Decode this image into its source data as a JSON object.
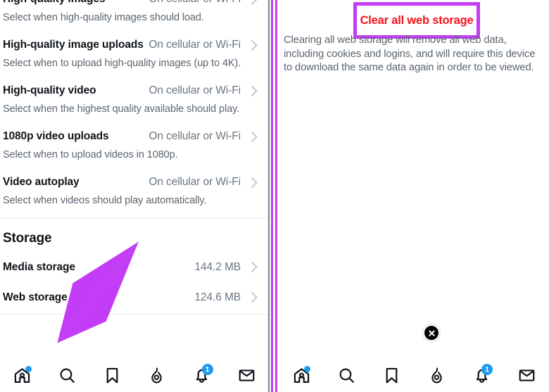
{
  "colors": {
    "accent_purple": "#c23df5",
    "alert_red": "#f4121a",
    "badge_blue": "#1d9bf0",
    "text_primary": "#0f1419",
    "text_secondary": "#5b6570",
    "divider": "#e9eaec"
  },
  "left_panel": {
    "settings_rows": [
      {
        "title": "High-quality images",
        "value": "On cellular or Wi-Fi",
        "description": "Select when high-quality images should load."
      },
      {
        "title": "High-quality image uploads",
        "value": "On cellular or Wi-Fi",
        "description": "Select when to upload high-quality images (up to 4K)."
      },
      {
        "title": "High-quality video",
        "value": "On cellular or Wi-Fi",
        "description": "Select when the highest quality available should play."
      },
      {
        "title": "1080p video uploads",
        "value": "On cellular or Wi-Fi",
        "description": "Select when to upload videos in 1080p."
      },
      {
        "title": "Video autoplay",
        "value": "On cellular or Wi-Fi",
        "description": "Select when videos should play automatically."
      }
    ],
    "storage_section": {
      "heading": "Storage",
      "rows": [
        {
          "title": "Media storage",
          "value": "144.2 MB"
        },
        {
          "title": "Web storage",
          "value": "124.6 MB"
        }
      ]
    }
  },
  "right_panel": {
    "clear_button_label": "Clear all web storage",
    "clear_description": "Clearing all web storage will remove all web data, including cookies and logins, and will require this device to download the same data again in order to be viewed.",
    "close_icon": "close-circle-icon"
  },
  "bottom_nav": {
    "items": [
      {
        "icon": "home-icon",
        "badge": "",
        "badge_type": "dot"
      },
      {
        "icon": "search-icon",
        "badge": "",
        "badge_type": "none"
      },
      {
        "icon": "bookmark-icon",
        "badge": "",
        "badge_type": "none"
      },
      {
        "icon": "flame-icon",
        "badge": "",
        "badge_type": "none"
      },
      {
        "icon": "notifications-icon",
        "badge": "1",
        "badge_type": "count"
      },
      {
        "icon": "messages-icon",
        "badge": "",
        "badge_type": "none"
      }
    ]
  },
  "annotation": {
    "arrow_color": "#c23df5",
    "arrow_points_to": "Web storage"
  }
}
